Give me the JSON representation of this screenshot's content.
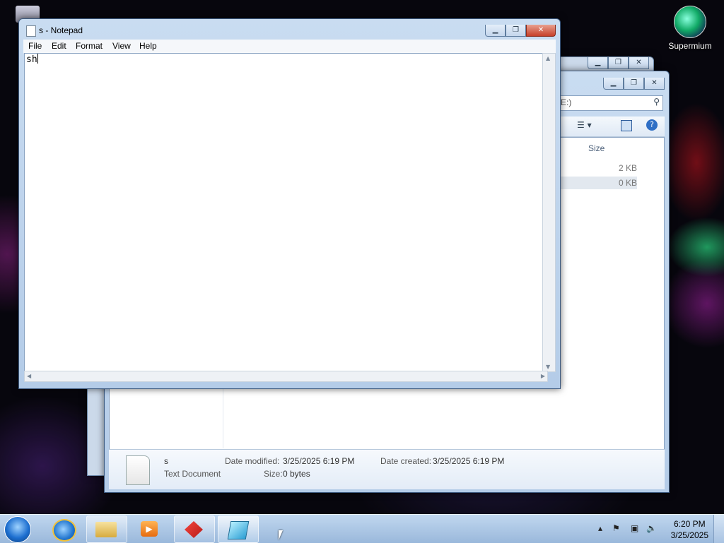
{
  "desktop": {
    "icons": [
      {
        "label": "Supermium"
      }
    ]
  },
  "notepad": {
    "title": "s - Notepad",
    "menu": [
      "File",
      "Edit",
      "Format",
      "View",
      "Help"
    ],
    "content": "sh"
  },
  "explorer": {
    "search_text": "E:)",
    "column_size": "Size",
    "rows": [
      {
        "size": "2 KB"
      },
      {
        "size": "0 KB"
      }
    ],
    "details": {
      "name": "s",
      "type": "Text Document",
      "date_modified_label": "Date modified:",
      "date_modified_value": "3/25/2025 6:19 PM",
      "date_created_label": "Date created:",
      "date_created_value": "3/25/2025 6:19 PM",
      "size_label": "Size:",
      "size_value": "0 bytes"
    }
  },
  "taskbar": {
    "time": "6:20 PM",
    "date": "3/25/2025"
  }
}
